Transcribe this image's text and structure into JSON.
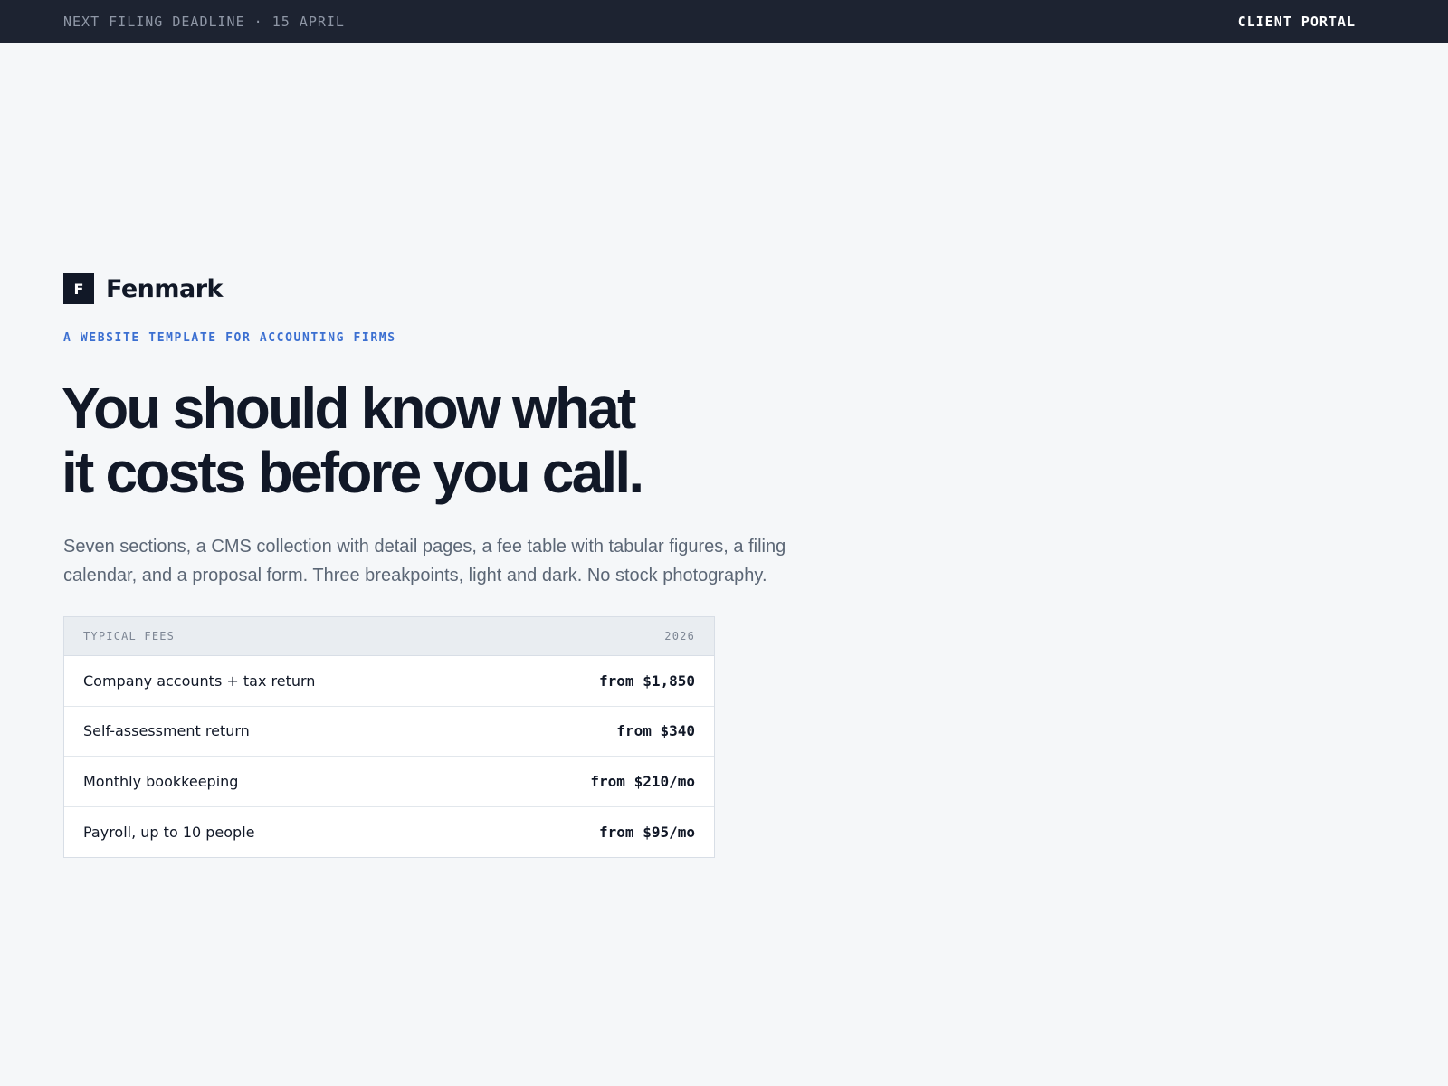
{
  "topbar": {
    "deadline": "NEXT FILING DEADLINE · 15 APRIL",
    "portal_label": "CLIENT PORTAL",
    "background": "#1d2331"
  },
  "brand": {
    "mark": "F",
    "name": "Fenmark"
  },
  "hero": {
    "eyebrow": "A WEBSITE TEMPLATE FOR ACCOUNTING FIRMS",
    "headline_line1": "You should know what",
    "headline_line2": "it costs before you call.",
    "lede": "Seven sections, a CMS collection with detail pages, a fee table with tabular figures, a filing calendar, and a proposal form. Three breakpoints, light and dark. No stock photography.",
    "accent": "#3b6fd1"
  },
  "fees": {
    "title": "TYPICAL FEES",
    "year": "2026",
    "rows": [
      {
        "label": "Company accounts + tax return",
        "price": "from $1,850"
      },
      {
        "label": "Self-assessment return",
        "price": "from $340"
      },
      {
        "label": "Monthly bookkeeping",
        "price": "from $210/mo"
      },
      {
        "label": "Payroll, up to 10 people",
        "price": "from $95/mo"
      }
    ]
  }
}
